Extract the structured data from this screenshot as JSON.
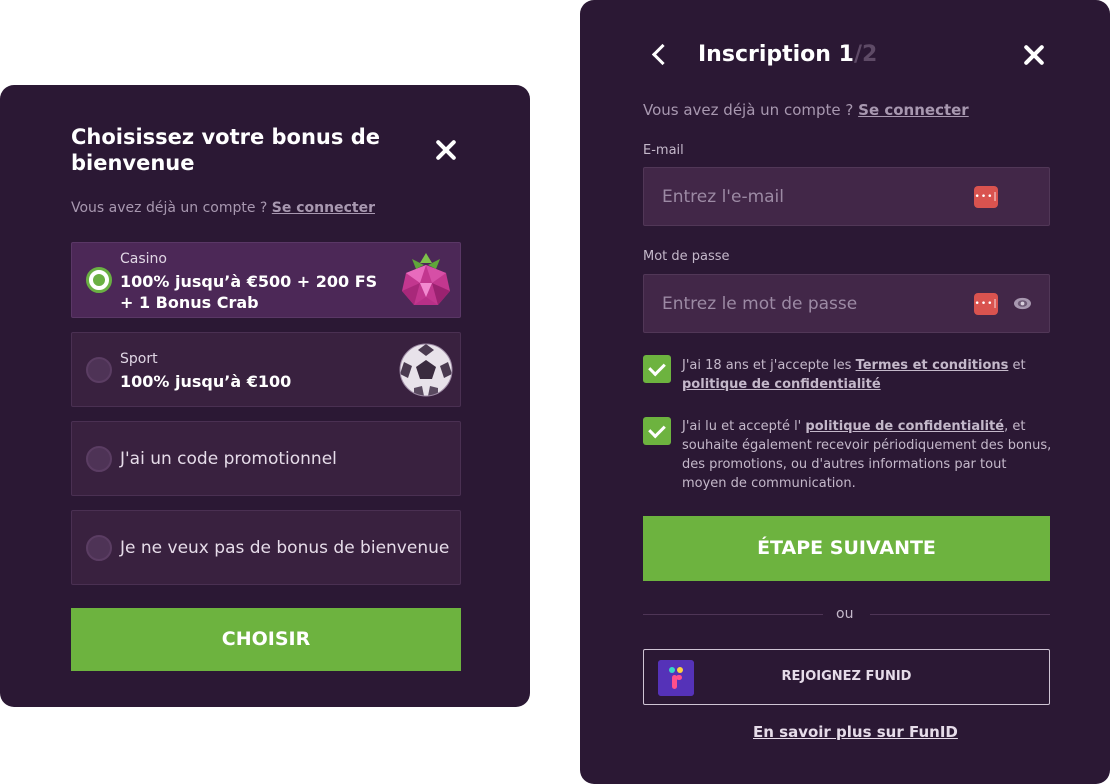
{
  "bonus_panel": {
    "title": "Choisissez votre bonus de bienvenue",
    "account_prompt": "Vous avez déjà un compte ?",
    "login_link": "Se connecter",
    "options": [
      {
        "category": "Casino",
        "line1": "100% jusqu’à €500 + 200 FS",
        "line2": "+ 1 Bonus Crab",
        "selected": true,
        "icon": "raspberry-gem-icon"
      },
      {
        "category": "Sport",
        "line1": "100% jusqu’à €100",
        "selected": false,
        "icon": "soccer-ball-icon"
      },
      {
        "label": "J'ai un code promotionnel",
        "selected": false
      },
      {
        "label": "Je ne veux pas de bonus de bienvenue",
        "selected": false
      }
    ],
    "choose_button": "CHOISIR"
  },
  "registration_panel": {
    "title": "Inscription 1",
    "title_step_total": "/2",
    "account_prompt": "Vous avez déjà un compte ?",
    "login_link": "Se connecter",
    "email": {
      "label": "E-mail",
      "placeholder": "Entrez l'e-mail",
      "value": ""
    },
    "password": {
      "label": "Mot de passe",
      "placeholder": "Entrez le mot de passe",
      "value": ""
    },
    "consent_terms": {
      "checked": true,
      "text_before": "J'ai 18 ans et j'accepte les ",
      "link1": "Termes et conditions",
      "text_mid": " et ",
      "link2": "politique de confidentialité"
    },
    "consent_marketing": {
      "checked": true,
      "text_before": "J'ai lu et accepté l' ",
      "link": "politique de confidentialité",
      "text_after": ", et souhaite également recevoir périodiquement des bonus, des promotions, ou d'autres informations par tout moyen de communication."
    },
    "next_button": "ÉTAPE SUIVANTE",
    "or_text": "ou",
    "funid_button": "REJOIGNEZ FUNID",
    "funid_more_link": "En savoir plus sur FunID"
  },
  "colors": {
    "panel_bg": "#2b1834",
    "accent_green": "#6db33f",
    "field_bg": "#422748",
    "selected_option_bg": "#4c2857",
    "funid_brand": "#5532b8",
    "password_manager_icon": "#d9534f"
  }
}
